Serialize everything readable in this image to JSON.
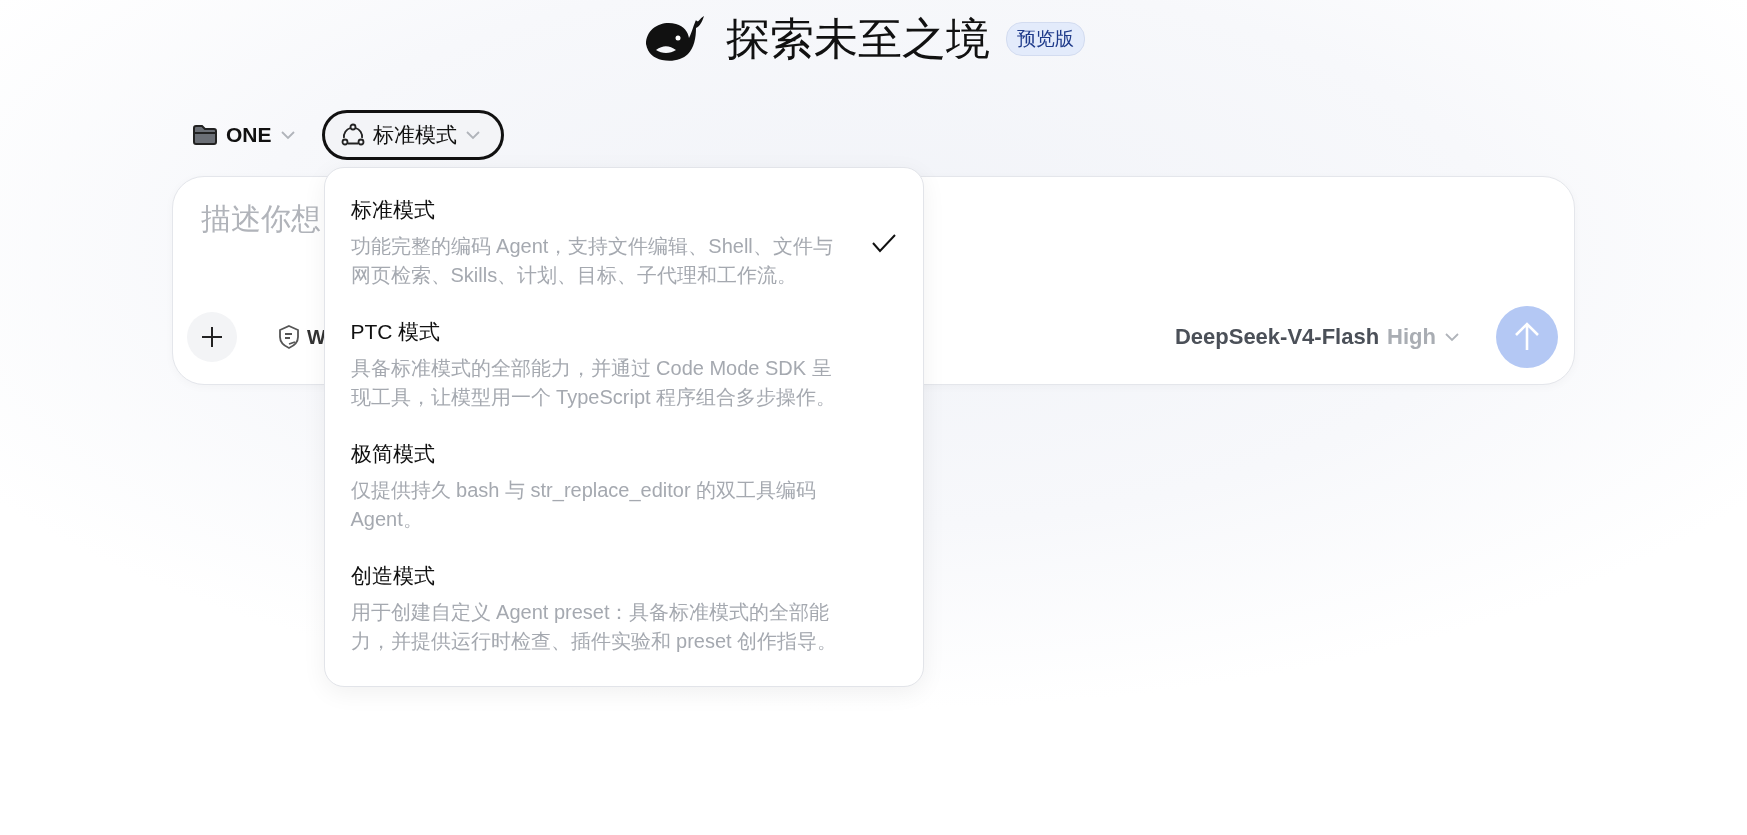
{
  "header": {
    "title": "探索未至之境",
    "badge": "预览版"
  },
  "toolbar": {
    "project": "ONE",
    "mode": "标准模式",
    "mode_menu_expanded": true
  },
  "composer": {
    "placeholder": "描述你想",
    "permission_label": "W",
    "model": "DeepSeek-V4-Flash",
    "effort": "High"
  },
  "mode_menu": {
    "items": [
      {
        "title": "标准模式",
        "description": "功能完整的编码 Agent，支持文件编辑、Shell、文件与网页检索、Skills、计划、目标、子代理和工作流。",
        "selected": true
      },
      {
        "title": "PTC 模式",
        "description": "具备标准模式的全部能力，并通过 Code Mode SDK 呈现工具，让模型用一个 TypeScript 程序组合多步操作。",
        "selected": false
      },
      {
        "title": "极简模式",
        "description": "仅提供持久 bash 与 str_replace_editor 的双工具编码 Agent。",
        "selected": false
      },
      {
        "title": "创造模式",
        "description": "用于创建自定义 Agent preset：具备标准模式的全部能力，并提供运行时检查、插件实验和 preset 创作指导。",
        "selected": false
      }
    ]
  }
}
